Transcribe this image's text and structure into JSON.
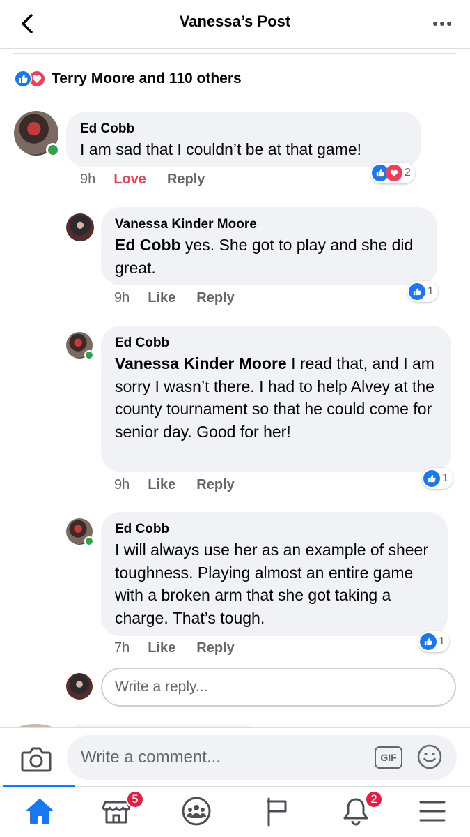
{
  "header": {
    "title": "Vanessa’s Post",
    "back_icon": "chevron-left-icon",
    "more_icon": "more-dots-icon"
  },
  "reactions_summary": {
    "text": "Terry Moore and 110 others",
    "icons": [
      "like-icon",
      "love-icon"
    ]
  },
  "comments": [
    {
      "author": "Ed Cobb",
      "text": "I am sad that I couldn’t be at that game!",
      "time": "9h",
      "actions": [
        "Love",
        "Reply"
      ],
      "reactions": [
        "like",
        "love"
      ],
      "reaction_count": "2",
      "online": true
    },
    {
      "author": "Vanessa Kinder Moore",
      "mention": "Ed Cobb",
      "text": " yes. She got to play and she did great.",
      "time": "9h",
      "actions": [
        "Like",
        "Reply"
      ],
      "reactions": [
        "like"
      ],
      "reaction_count": "1"
    },
    {
      "author": "Ed Cobb",
      "mention": "Vanessa Kinder Moore",
      "text": " I read that, and I am sorry I wasn’t there.  I had to help Alvey at the county tournament so that he could come for senior day.  Good for her!",
      "time": "9h",
      "actions": [
        "Like",
        "Reply"
      ],
      "reactions": [
        "like"
      ],
      "reaction_count": "1",
      "online": true
    },
    {
      "author": "Ed Cobb",
      "text": "I will always use her as an example of sheer toughness.  Playing almost an entire game with a broken arm that she got taking a charge. That’s tough.",
      "time": "7h",
      "actions": [
        "Like",
        "Reply"
      ],
      "reactions": [
        "like"
      ],
      "reaction_count": "1",
      "online": true
    }
  ],
  "reply_input": {
    "placeholder": "Write a reply..."
  },
  "composer": {
    "placeholder": "Write a comment...",
    "gif_label": "GIF",
    "camera_icon": "camera-icon",
    "emoji_icon": "emoji-icon"
  },
  "tabbar": {
    "tabs": [
      {
        "name": "home",
        "icon": "home-icon",
        "active": true
      },
      {
        "name": "marketplace",
        "icon": "marketplace-icon",
        "badge": "5"
      },
      {
        "name": "groups",
        "icon": "groups-icon"
      },
      {
        "name": "pages",
        "icon": "flag-icon"
      },
      {
        "name": "notifications",
        "icon": "bell-icon",
        "badge": "2"
      },
      {
        "name": "menu",
        "icon": "menu-icon"
      }
    ]
  },
  "colors": {
    "brand": "#1877f2",
    "love": "#f33e58",
    "bubble": "#f0f2f5",
    "secondary_text": "#65676b",
    "online": "#31a24c",
    "notification": "#e41e3f"
  }
}
